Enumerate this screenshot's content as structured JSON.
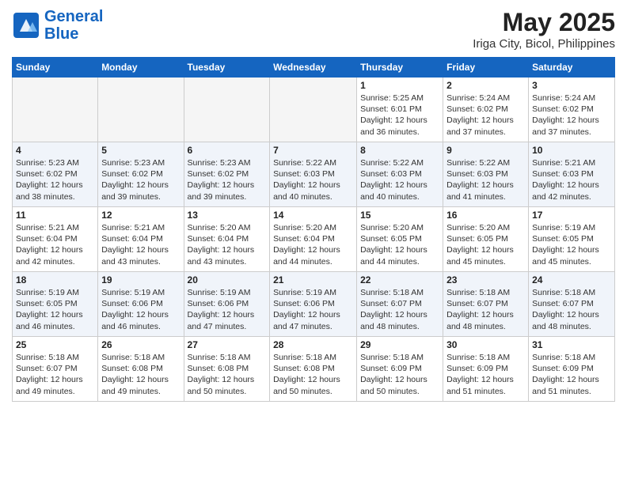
{
  "header": {
    "logo_line1": "General",
    "logo_line2": "Blue",
    "month": "May 2025",
    "location": "Iriga City, Bicol, Philippines"
  },
  "weekdays": [
    "Sunday",
    "Monday",
    "Tuesday",
    "Wednesday",
    "Thursday",
    "Friday",
    "Saturday"
  ],
  "weeks": [
    [
      {
        "day": "",
        "info": ""
      },
      {
        "day": "",
        "info": ""
      },
      {
        "day": "",
        "info": ""
      },
      {
        "day": "",
        "info": ""
      },
      {
        "day": "1",
        "info": "Sunrise: 5:25 AM\nSunset: 6:01 PM\nDaylight: 12 hours\nand 36 minutes."
      },
      {
        "day": "2",
        "info": "Sunrise: 5:24 AM\nSunset: 6:02 PM\nDaylight: 12 hours\nand 37 minutes."
      },
      {
        "day": "3",
        "info": "Sunrise: 5:24 AM\nSunset: 6:02 PM\nDaylight: 12 hours\nand 37 minutes."
      }
    ],
    [
      {
        "day": "4",
        "info": "Sunrise: 5:23 AM\nSunset: 6:02 PM\nDaylight: 12 hours\nand 38 minutes."
      },
      {
        "day": "5",
        "info": "Sunrise: 5:23 AM\nSunset: 6:02 PM\nDaylight: 12 hours\nand 39 minutes."
      },
      {
        "day": "6",
        "info": "Sunrise: 5:23 AM\nSunset: 6:02 PM\nDaylight: 12 hours\nand 39 minutes."
      },
      {
        "day": "7",
        "info": "Sunrise: 5:22 AM\nSunset: 6:03 PM\nDaylight: 12 hours\nand 40 minutes."
      },
      {
        "day": "8",
        "info": "Sunrise: 5:22 AM\nSunset: 6:03 PM\nDaylight: 12 hours\nand 40 minutes."
      },
      {
        "day": "9",
        "info": "Sunrise: 5:22 AM\nSunset: 6:03 PM\nDaylight: 12 hours\nand 41 minutes."
      },
      {
        "day": "10",
        "info": "Sunrise: 5:21 AM\nSunset: 6:03 PM\nDaylight: 12 hours\nand 42 minutes."
      }
    ],
    [
      {
        "day": "11",
        "info": "Sunrise: 5:21 AM\nSunset: 6:04 PM\nDaylight: 12 hours\nand 42 minutes."
      },
      {
        "day": "12",
        "info": "Sunrise: 5:21 AM\nSunset: 6:04 PM\nDaylight: 12 hours\nand 43 minutes."
      },
      {
        "day": "13",
        "info": "Sunrise: 5:20 AM\nSunset: 6:04 PM\nDaylight: 12 hours\nand 43 minutes."
      },
      {
        "day": "14",
        "info": "Sunrise: 5:20 AM\nSunset: 6:04 PM\nDaylight: 12 hours\nand 44 minutes."
      },
      {
        "day": "15",
        "info": "Sunrise: 5:20 AM\nSunset: 6:05 PM\nDaylight: 12 hours\nand 44 minutes."
      },
      {
        "day": "16",
        "info": "Sunrise: 5:20 AM\nSunset: 6:05 PM\nDaylight: 12 hours\nand 45 minutes."
      },
      {
        "day": "17",
        "info": "Sunrise: 5:19 AM\nSunset: 6:05 PM\nDaylight: 12 hours\nand 45 minutes."
      }
    ],
    [
      {
        "day": "18",
        "info": "Sunrise: 5:19 AM\nSunset: 6:05 PM\nDaylight: 12 hours\nand 46 minutes."
      },
      {
        "day": "19",
        "info": "Sunrise: 5:19 AM\nSunset: 6:06 PM\nDaylight: 12 hours\nand 46 minutes."
      },
      {
        "day": "20",
        "info": "Sunrise: 5:19 AM\nSunset: 6:06 PM\nDaylight: 12 hours\nand 47 minutes."
      },
      {
        "day": "21",
        "info": "Sunrise: 5:19 AM\nSunset: 6:06 PM\nDaylight: 12 hours\nand 47 minutes."
      },
      {
        "day": "22",
        "info": "Sunrise: 5:18 AM\nSunset: 6:07 PM\nDaylight: 12 hours\nand 48 minutes."
      },
      {
        "day": "23",
        "info": "Sunrise: 5:18 AM\nSunset: 6:07 PM\nDaylight: 12 hours\nand 48 minutes."
      },
      {
        "day": "24",
        "info": "Sunrise: 5:18 AM\nSunset: 6:07 PM\nDaylight: 12 hours\nand 48 minutes."
      }
    ],
    [
      {
        "day": "25",
        "info": "Sunrise: 5:18 AM\nSunset: 6:07 PM\nDaylight: 12 hours\nand 49 minutes."
      },
      {
        "day": "26",
        "info": "Sunrise: 5:18 AM\nSunset: 6:08 PM\nDaylight: 12 hours\nand 49 minutes."
      },
      {
        "day": "27",
        "info": "Sunrise: 5:18 AM\nSunset: 6:08 PM\nDaylight: 12 hours\nand 50 minutes."
      },
      {
        "day": "28",
        "info": "Sunrise: 5:18 AM\nSunset: 6:08 PM\nDaylight: 12 hours\nand 50 minutes."
      },
      {
        "day": "29",
        "info": "Sunrise: 5:18 AM\nSunset: 6:09 PM\nDaylight: 12 hours\nand 50 minutes."
      },
      {
        "day": "30",
        "info": "Sunrise: 5:18 AM\nSunset: 6:09 PM\nDaylight: 12 hours\nand 51 minutes."
      },
      {
        "day": "31",
        "info": "Sunrise: 5:18 AM\nSunset: 6:09 PM\nDaylight: 12 hours\nand 51 minutes."
      }
    ]
  ]
}
